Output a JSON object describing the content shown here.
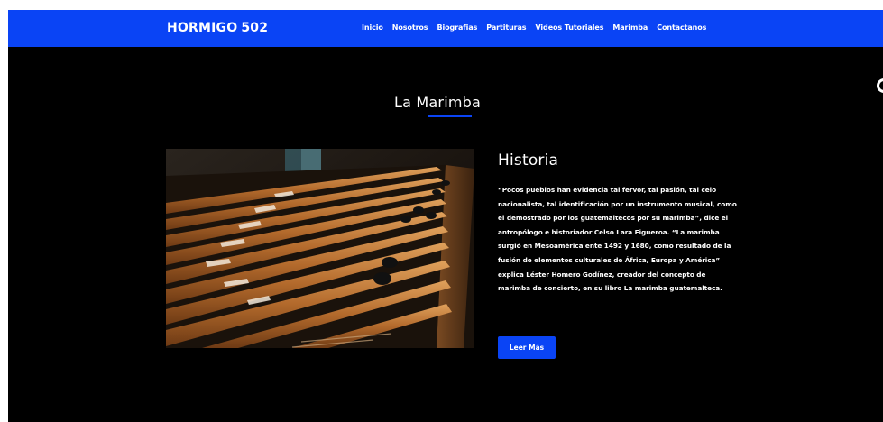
{
  "header": {
    "brand_name": "HORMIGO",
    "brand_number": "502",
    "nav_items": [
      "Inicio",
      "Nosotros",
      "Biografias",
      "Partituras",
      "Videos Tutoriales",
      "Marimba",
      "Contactanos"
    ]
  },
  "main": {
    "section_title": "La Marimba",
    "history": {
      "heading": "Historia",
      "paragraph": "“Pocos pueblos han evidencia tal fervor, tal pasión, tal celo nacionalista, tal identificación por un instrumento musical, como el demostrado por los guatemaltecos por su marimba”, dice el antropólogo e historiador Celso Lara Figueroa. “La marimba surgió en Mesoamérica ente 1492 y 1680, como resultado de la fusión de elementos culturales de África, Europa y América” explica Léster Homero Godínez, creador del concepto de marimba de concierto, en su libro La marimba guatemalteca.",
      "button_label": "Leer Más"
    }
  },
  "colors": {
    "accent_blue": "#0a44f5",
    "background": "#000000",
    "text": "#ffffff"
  }
}
